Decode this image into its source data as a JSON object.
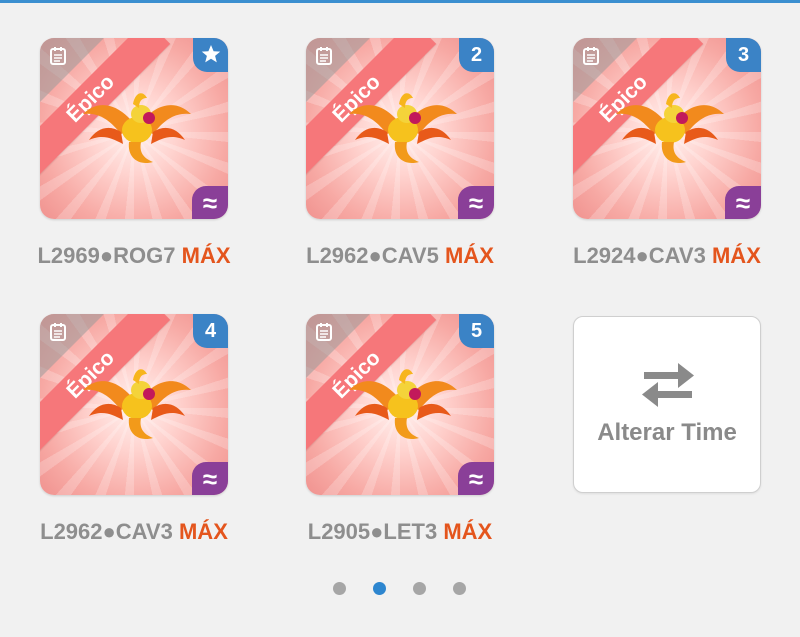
{
  "cards": [
    {
      "ribbon": "Épico",
      "badge_type": "star",
      "badge": "",
      "code": "L2969●ROG7",
      "level": "MÁX"
    },
    {
      "ribbon": "Épico",
      "badge_type": "number",
      "badge": "2",
      "code": "L2962●CAV5",
      "level": "MÁX"
    },
    {
      "ribbon": "Épico",
      "badge_type": "number",
      "badge": "3",
      "code": "L2924●CAV3",
      "level": "MÁX"
    },
    {
      "ribbon": "Épico",
      "badge_type": "number",
      "badge": "4",
      "code": "L2962●CAV3",
      "level": "MÁX"
    },
    {
      "ribbon": "Épico",
      "badge_type": "number",
      "badge": "5",
      "code": "L2905●LET3",
      "level": "MÁX"
    }
  ],
  "change_team": {
    "label": "Alterar Time"
  },
  "element_symbol": "≈",
  "pagination": {
    "count": 4,
    "active_index": 1
  },
  "colors": {
    "accent": "#3b83c6",
    "max": "#e4551d",
    "ribbon": "#f6777a",
    "element": "#8a3f98"
  },
  "icons": {
    "notepad": "notepad-icon",
    "star": "star-icon",
    "swap": "swap-arrows-icon",
    "dragon": "dragon-artwork"
  }
}
